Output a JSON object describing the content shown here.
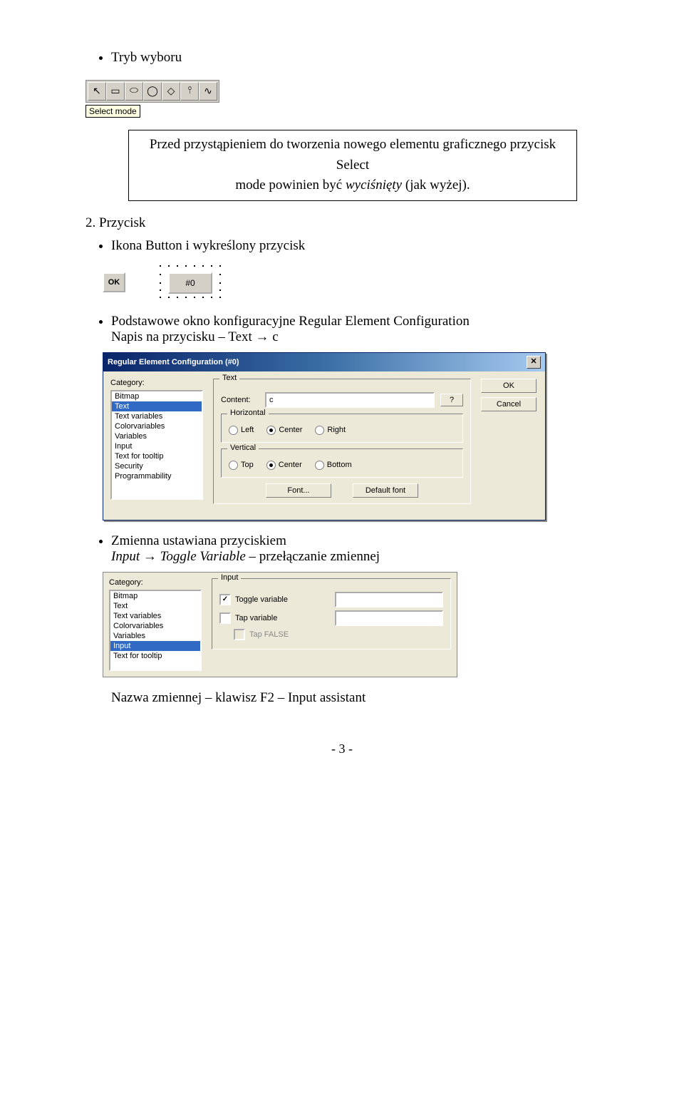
{
  "bullets": {
    "b1": "Tryb wyboru",
    "b2": "Ikona Button i wykreślony przycisk",
    "b3": "Podstawowe okno konfiguracyjne Regular Element Configuration",
    "b3_line2": "Napis na przycisku – Text → c",
    "b4": "Zmienna ustawiana przyciskiem",
    "b4_line2a": "Input",
    "b4_line2b": "Toggle Variable",
    "b4_line2c": "– przełączanie zmiennej",
    "b5": "Nazwa zmiennej – klawisz F2 – Input assistant"
  },
  "note": {
    "line1_a": "Przed przystąpieniem do tworzenia nowego elementu graficznego przycisk Select",
    "line2_a": "mode powinien być ",
    "line2_b": "wyciśnięty",
    "line2_c": " (jak wyżej)."
  },
  "section2": "2. Przycisk",
  "toolbar": {
    "tooltip": "Select mode",
    "icons": [
      "↖",
      "▭",
      "⬭",
      "◯",
      "◇",
      "⫯",
      "∿"
    ]
  },
  "okbtn": "OK",
  "sketch_label": "#0",
  "dialog": {
    "title": "Regular Element Configuration (#0)",
    "category_label": "Category:",
    "categories": [
      "Bitmap",
      "Text",
      "Text variables",
      "Colorvariables",
      "Variables",
      "Input",
      "Text for tooltip",
      "Security",
      "Programmability"
    ],
    "selected_category_index": 1,
    "text_group": "Text",
    "content_label": "Content:",
    "content_value": "c",
    "q": "?",
    "horiz_group": "Horizontal",
    "horiz_options": [
      "Left",
      "Center",
      "Right"
    ],
    "horiz_selected": 1,
    "vert_group": "Vertical",
    "vert_options": [
      "Top",
      "Center",
      "Bottom"
    ],
    "vert_selected": 1,
    "font_btn": "Font...",
    "default_font_btn": "Default font",
    "ok": "OK",
    "cancel": "Cancel"
  },
  "dialog2": {
    "category_label": "Category:",
    "categories": [
      "Bitmap",
      "Text",
      "Text variables",
      "Colorvariables",
      "Variables",
      "Input",
      "Text for tooltip"
    ],
    "selected_category_index": 5,
    "input_group": "Input",
    "toggle_var": "Toggle variable",
    "tap_var": "Tap variable",
    "tap_false": "Tap FALSE",
    "toggle_field": "",
    "tap_field": ""
  },
  "pagenum": "- 3 -"
}
